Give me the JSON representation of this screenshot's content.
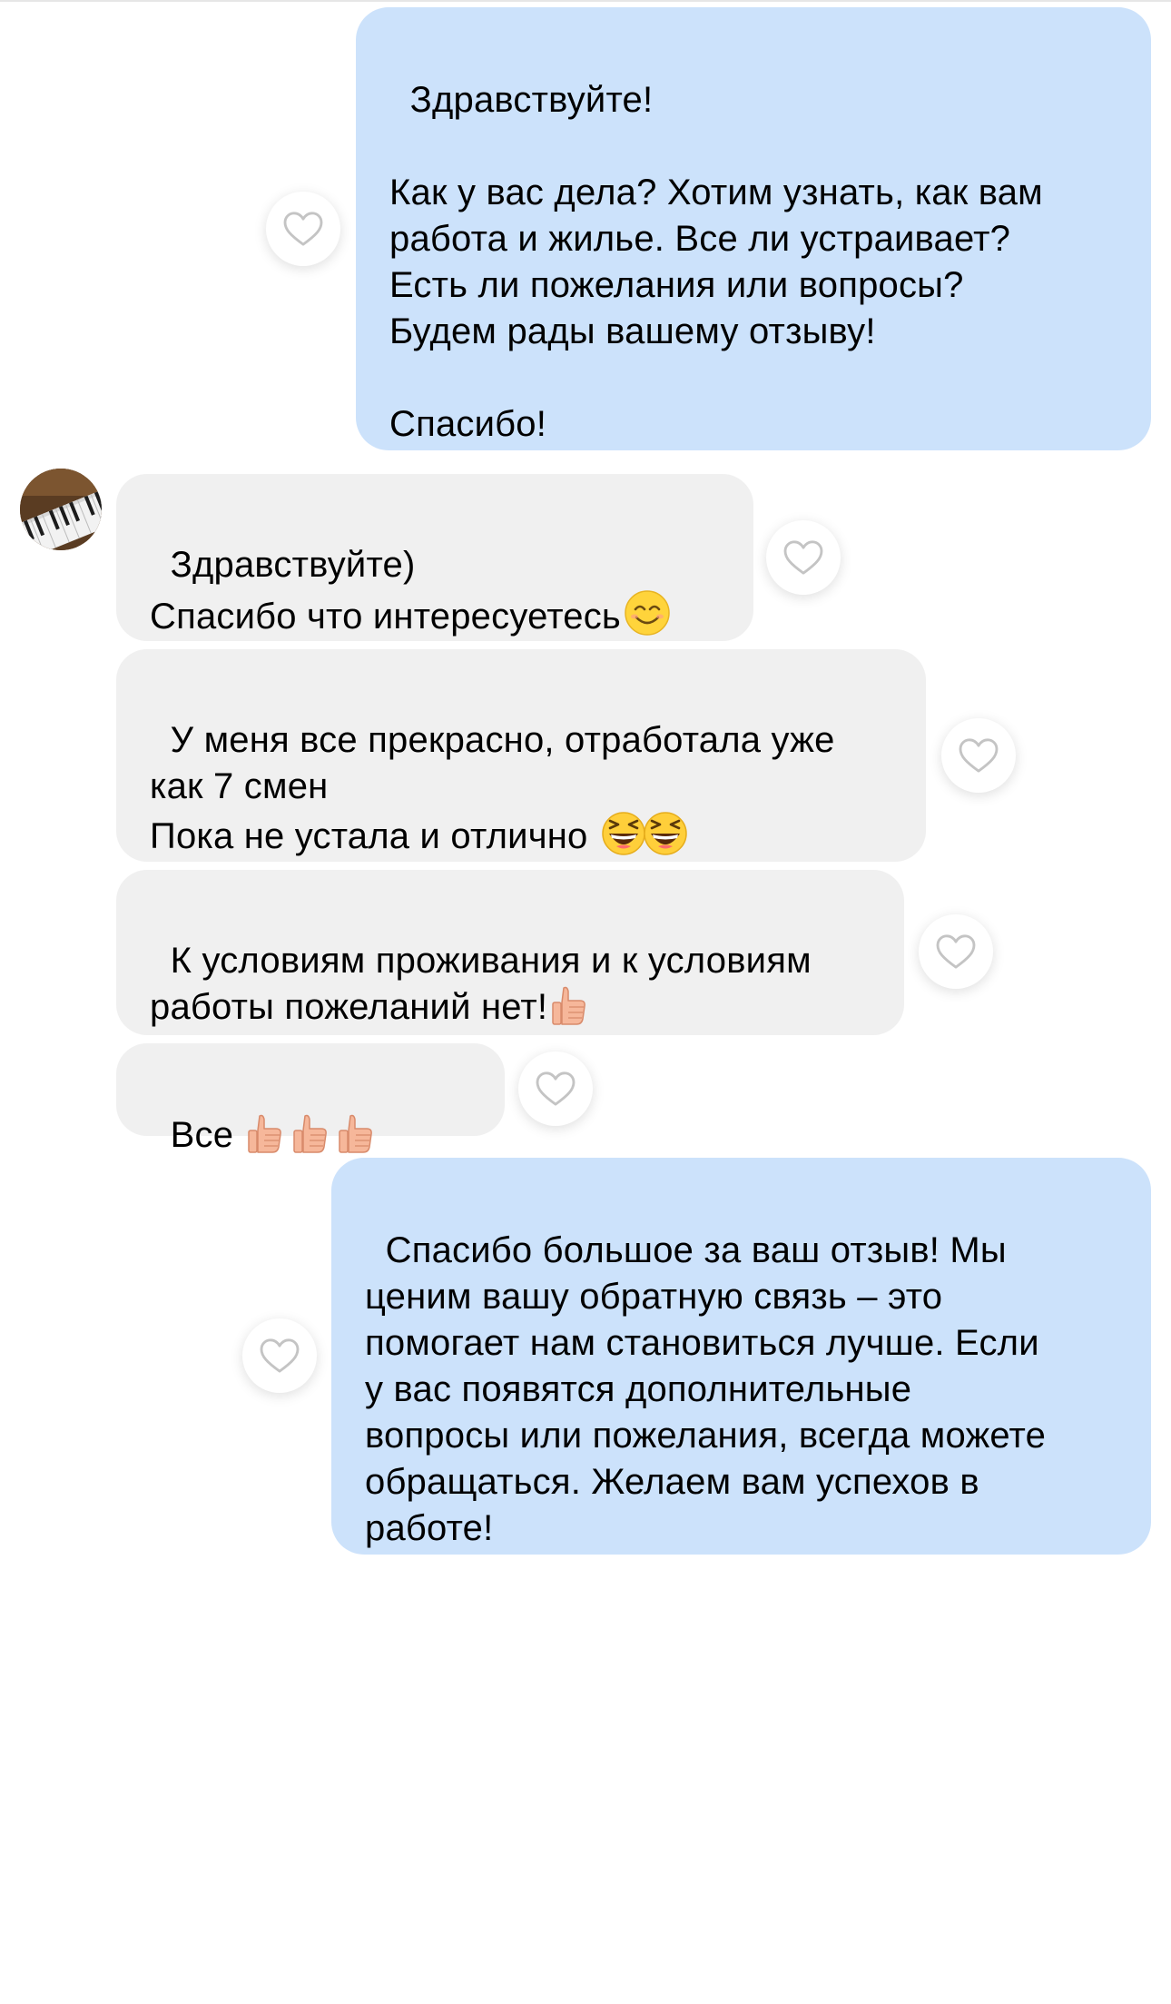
{
  "messages": [
    {
      "id": "m1",
      "direction": "outgoing",
      "text": "Здравствуйте!\n\nКак у вас дела? Хотим узнать, как вам\nработа и жилье. Все ли устраивает?\nЕсть ли пожелания или вопросы?\nБудем рады вашему отзыву!\n\nСпасибо!"
    },
    {
      "id": "m2",
      "direction": "incoming",
      "text": "Здравствуйте)\nСпасибо что интересуетесь",
      "emoji": [
        "smiling-face-emoji"
      ]
    },
    {
      "id": "m3",
      "direction": "incoming",
      "text": "У меня все прекрасно, отработала уже\nкак 7 смен\nПока не устала и отлично ",
      "emoji": [
        "laughing-face-emoji",
        "laughing-face-emoji"
      ]
    },
    {
      "id": "m4",
      "direction": "incoming",
      "text": "К условиям проживания и к условиям\nработы пожеланий нет!",
      "emoji": [
        "thumbs-up-emoji"
      ]
    },
    {
      "id": "m5",
      "direction": "incoming",
      "text": "Все ",
      "emoji": [
        "thumbs-up-emoji",
        "thumbs-up-emoji",
        "thumbs-up-emoji"
      ]
    },
    {
      "id": "m6",
      "direction": "outgoing",
      "text": "Спасибо большое за ваш отзыв! Мы\nценим вашу обратную связь – это\nпомогает нам становиться лучше. Если\nу вас появятся дополнительные\nвопросы или пожелания, всегда можете\nобращаться. Желаем вам успехов в\nработе!"
    }
  ],
  "reaction_icon": "heart-outline-icon",
  "colors": {
    "outgoing_bubble": "#cce2fb",
    "incoming_bubble": "#f0f0f0",
    "heart_stroke": "#c4c4c4",
    "background": "#ffffff"
  },
  "avatar": {
    "icon": "piano-keys-avatar"
  }
}
